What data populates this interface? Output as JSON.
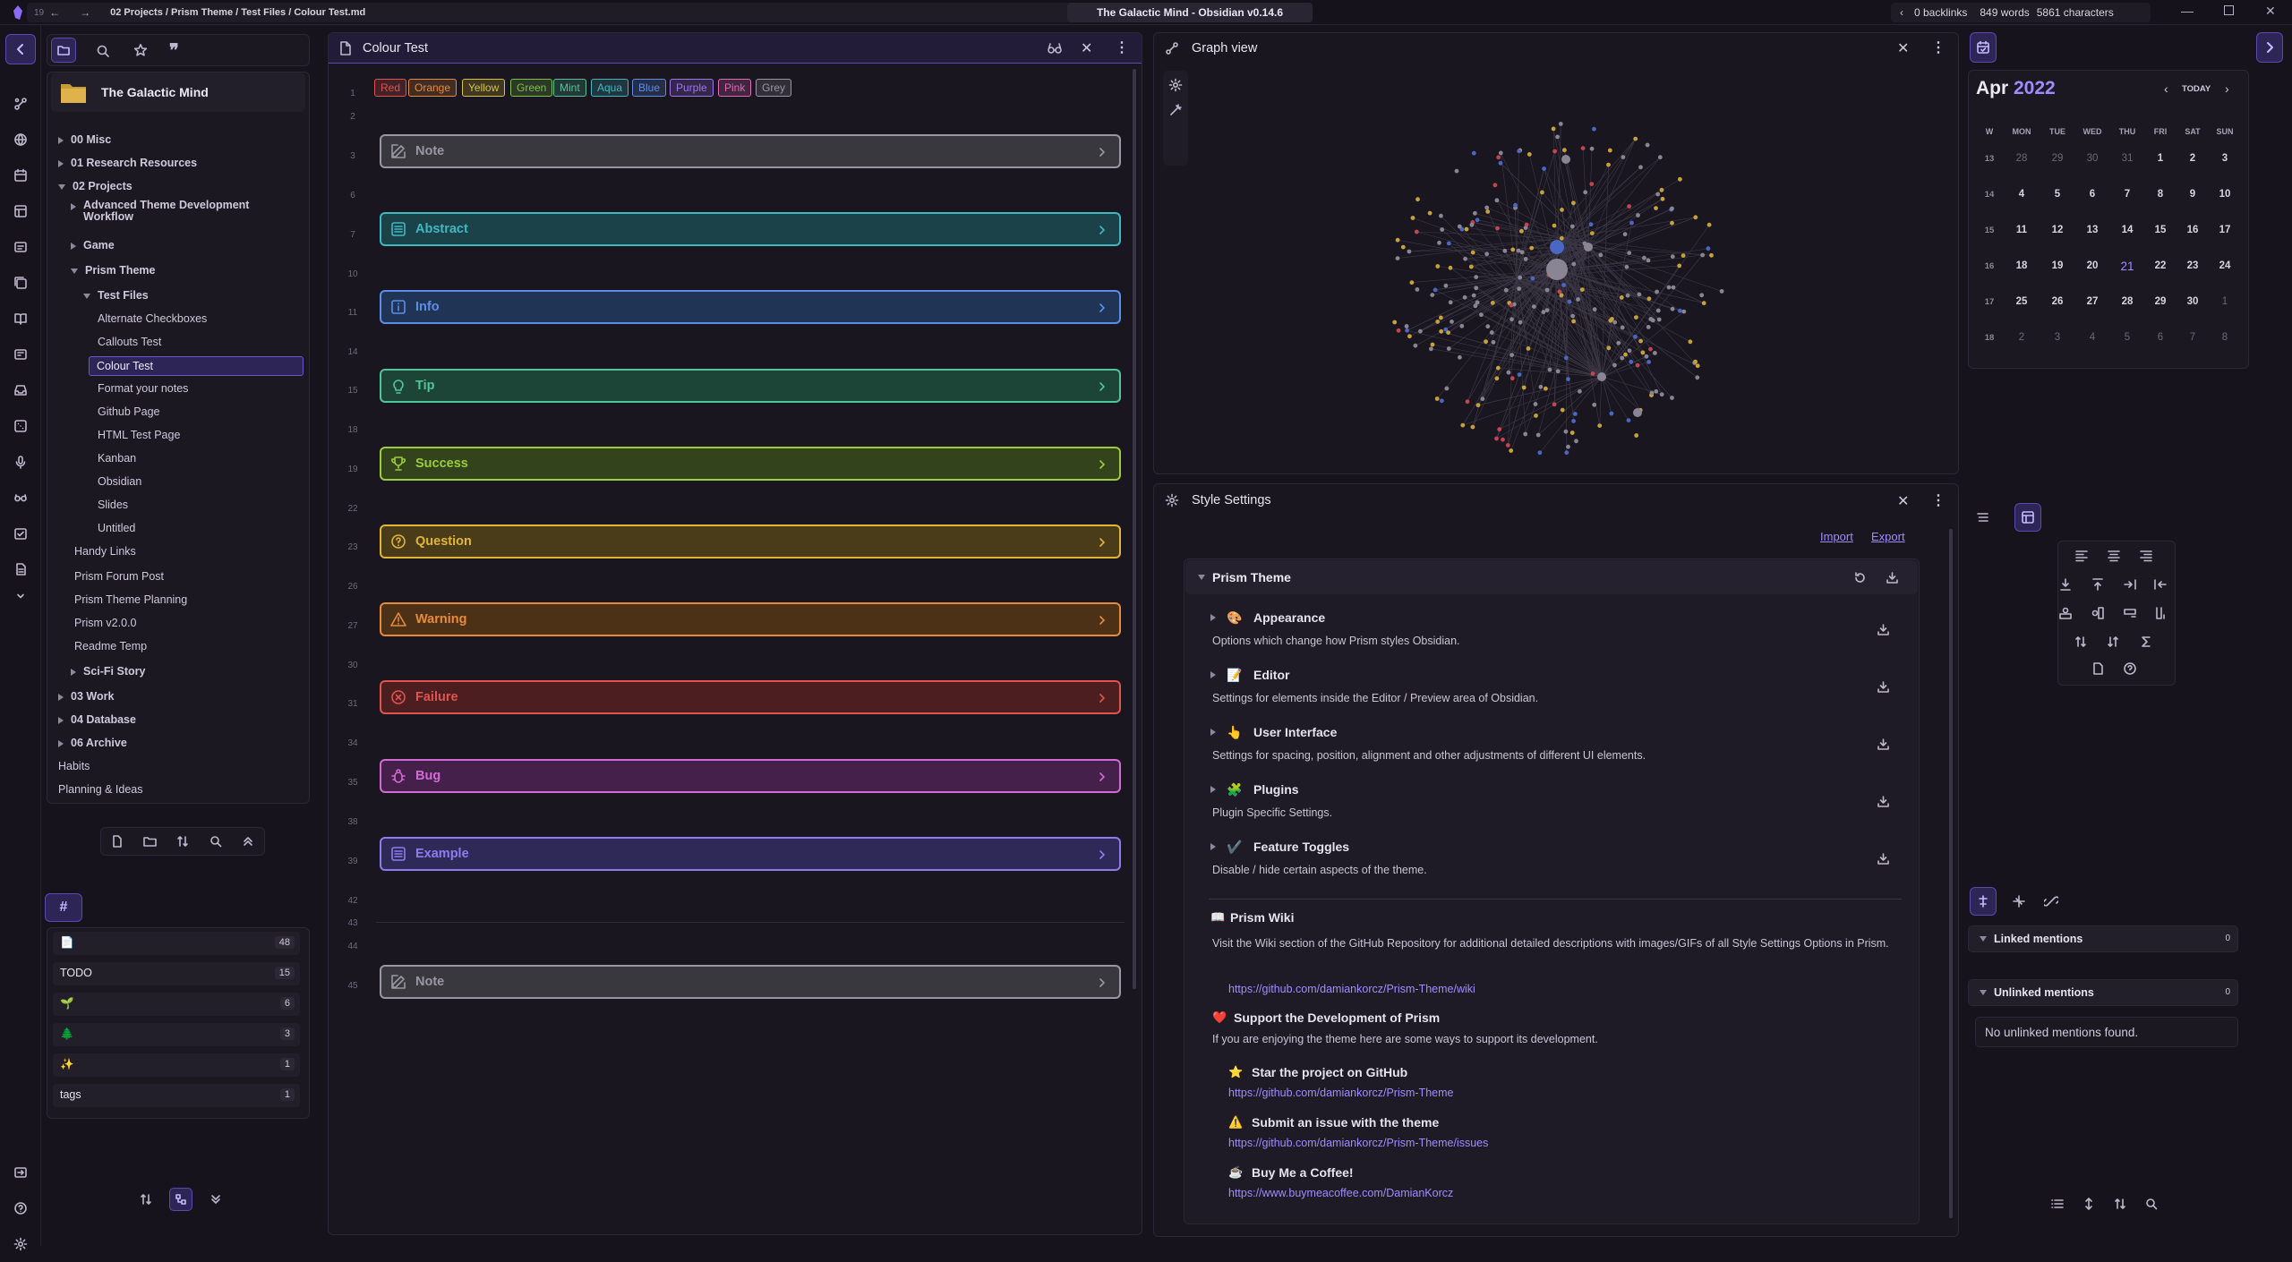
{
  "titlebar": {
    "breadcrumb": "02 Projects / Prism Theme / Test Files / Colour Test.md",
    "history_count": "19",
    "app_title": "The Galactic Mind - Obsidian v0.14.6",
    "backlinks": "0 backlinks",
    "words": "849 words",
    "characters": "5861 characters"
  },
  "vault": {
    "name": "The Galactic Mind"
  },
  "file_tree": [
    {
      "label": "00 Misc",
      "type": "folder-closed"
    },
    {
      "label": "01 Research Resources",
      "type": "folder-closed"
    },
    {
      "label": "02 Projects",
      "type": "folder-open"
    },
    {
      "label": "Advanced Theme Development Workflow",
      "type": "folder-closed"
    },
    {
      "label": "Game",
      "type": "folder-closed"
    },
    {
      "label": "Prism Theme",
      "type": "folder-open"
    },
    {
      "label": "Test Files",
      "type": "folder-open"
    },
    {
      "label": "Alternate Checkboxes",
      "type": "file"
    },
    {
      "label": "Callouts Test",
      "type": "file"
    },
    {
      "label": "Colour Test",
      "type": "file-active"
    },
    {
      "label": "Format your notes",
      "type": "file"
    },
    {
      "label": "Github Page",
      "type": "file"
    },
    {
      "label": "HTML Test Page",
      "type": "file"
    },
    {
      "label": "Kanban",
      "type": "file"
    },
    {
      "label": "Obsidian",
      "type": "file"
    },
    {
      "label": "Slides",
      "type": "file"
    },
    {
      "label": "Untitled",
      "type": "file"
    },
    {
      "label": "Handy Links",
      "type": "file"
    },
    {
      "label": "Prism Forum Post",
      "type": "file"
    },
    {
      "label": "Prism Theme Planning",
      "type": "file"
    },
    {
      "label": "Prism v2.0.0",
      "type": "file"
    },
    {
      "label": "Readme Temp",
      "type": "file"
    },
    {
      "label": "Sci-Fi Story",
      "type": "folder-closed"
    },
    {
      "label": "03 Work",
      "type": "folder-closed"
    },
    {
      "label": "04 Database",
      "type": "folder-closed"
    },
    {
      "label": "06 Archive",
      "type": "folder-closed"
    },
    {
      "label": "Habits",
      "type": "file"
    },
    {
      "label": "Planning & Ideas",
      "type": "file"
    }
  ],
  "tags_pane": {
    "rows": [
      {
        "label": "📄",
        "count": "48"
      },
      {
        "label": "TODO",
        "count": "15"
      },
      {
        "label": "🌱",
        "count": "6"
      },
      {
        "label": "🌲",
        "count": "3"
      },
      {
        "label": "✨",
        "count": "1"
      },
      {
        "label": "tags",
        "count": "1"
      }
    ]
  },
  "editor": {
    "tab_title": "Colour Test",
    "colour_tags": [
      {
        "label": "Red",
        "color": "#e0534f"
      },
      {
        "label": "Orange",
        "color": "#e68a3c"
      },
      {
        "label": "Yellow",
        "color": "#d9c142"
      },
      {
        "label": "Green",
        "color": "#7bc14a"
      },
      {
        "label": "Mint",
        "color": "#53c49a"
      },
      {
        "label": "Aqua",
        "color": "#3fb8c4"
      },
      {
        "label": "Blue",
        "color": "#5c8ee8"
      },
      {
        "label": "Purple",
        "color": "#a073f0"
      },
      {
        "label": "Pink",
        "color": "#e06ac0"
      },
      {
        "label": "Grey",
        "color": "#9a96a3"
      }
    ],
    "line_numbers": [
      "1",
      "2",
      "3",
      "6",
      "7",
      "10",
      "11",
      "14",
      "15",
      "18",
      "19",
      "22",
      "23",
      "26",
      "27",
      "30",
      "31",
      "34",
      "35",
      "38",
      "39",
      "42",
      "43",
      "44",
      "45"
    ],
    "callouts": [
      {
        "label": "Note",
        "color": "#9a96a3",
        "bg": "#3a383f",
        "icon": "pencil-icon"
      },
      {
        "label": "Abstract",
        "color": "#3fb8c4",
        "bg": "#1b4248",
        "icon": "list-icon"
      },
      {
        "label": "Info",
        "color": "#5c8ee8",
        "bg": "#203556",
        "icon": "info-icon"
      },
      {
        "label": "Tip",
        "color": "#53c49a",
        "bg": "#1c4537",
        "icon": "bulb-icon"
      },
      {
        "label": "Success",
        "color": "#9ccc3d",
        "bg": "#33431b",
        "icon": "trophy-icon"
      },
      {
        "label": "Question",
        "color": "#e0b53a",
        "bg": "#4a3c18",
        "icon": "help-icon"
      },
      {
        "label": "Warning",
        "color": "#e68a3c",
        "bg": "#4d3117",
        "icon": "warning-icon"
      },
      {
        "label": "Failure",
        "color": "#e0534f",
        "bg": "#4d1e20",
        "icon": "x-circle-icon"
      },
      {
        "label": "Bug",
        "color": "#d36bd6",
        "bg": "#45204a",
        "icon": "bug-icon"
      },
      {
        "label": "Example",
        "color": "#8c7cf0",
        "bg": "#2f2958",
        "icon": "list-icon"
      },
      {
        "label": "Note",
        "color": "#9a96a3",
        "bg": "#3a383f",
        "icon": "pencil-icon"
      }
    ]
  },
  "graph": {
    "title": "Graph view"
  },
  "style_settings": {
    "title": "Style Settings",
    "import": "Import",
    "export": "Export",
    "theme": "Prism Theme",
    "sections": [
      {
        "emoji": "🎨",
        "title": "Appearance",
        "desc": "Options which change how Prism styles Obsidian."
      },
      {
        "emoji": "📝",
        "title": "Editor",
        "desc": "Settings for elements inside the Editor / Preview area of Obsidian."
      },
      {
        "emoji": "👆",
        "title": "User Interface",
        "desc": "Settings for spacing, position, alignment and other adjustments of different UI elements."
      },
      {
        "emoji": "🧩",
        "title": "Plugins",
        "desc": "Plugin Specific Settings."
      },
      {
        "emoji": "✔️",
        "title": "Feature Toggles",
        "desc": "Disable / hide certain aspects of the theme."
      }
    ],
    "wiki": {
      "emoji": "📖",
      "title": "Prism Wiki",
      "desc": "Visit the Wiki section of the GitHub Repository for additional detailed descriptions with images/GIFs of all Style Settings Options in Prism.",
      "link": "https://github.com/damiankorcz/Prism-Theme/wiki"
    },
    "support": {
      "emoji": "❤️",
      "title": "Support the Development of Prism",
      "desc": "If you are enjoying the theme here are some ways to support its development.",
      "items": [
        {
          "emoji": "⭐",
          "title": "Star the project on GitHub",
          "link": "https://github.com/damiankorcz/Prism-Theme"
        },
        {
          "emoji": "⚠️",
          "title": "Submit an issue with the theme",
          "link": "https://github.com/damiankorcz/Prism-Theme/issues"
        },
        {
          "emoji": "☕",
          "title": "Buy Me a Coffee!",
          "link": "https://www.buymeacoffee.com/DamianKorcz"
        }
      ]
    }
  },
  "calendar": {
    "month": "Apr",
    "year": "2022",
    "today_label": "TODAY",
    "week_header": "W",
    "days": [
      "MON",
      "TUE",
      "WED",
      "THU",
      "FRI",
      "SAT",
      "SUN"
    ],
    "weeks": [
      {
        "wk": "13",
        "d": [
          "28",
          "29",
          "30",
          "31",
          "1",
          "2",
          "3"
        ]
      },
      {
        "wk": "14",
        "d": [
          "4",
          "5",
          "6",
          "7",
          "8",
          "9",
          "10"
        ]
      },
      {
        "wk": "15",
        "d": [
          "11",
          "12",
          "13",
          "14",
          "15",
          "16",
          "17"
        ]
      },
      {
        "wk": "16",
        "d": [
          "18",
          "19",
          "20",
          "21",
          "22",
          "23",
          "24"
        ]
      },
      {
        "wk": "17",
        "d": [
          "25",
          "26",
          "27",
          "28",
          "29",
          "30",
          "1"
        ]
      },
      {
        "wk": "18",
        "d": [
          "2",
          "3",
          "4",
          "5",
          "6",
          "7",
          "8"
        ]
      }
    ],
    "today": "21"
  },
  "backlinks": {
    "linked": "Linked mentions",
    "linked_count": "0",
    "unlinked": "Unlinked mentions",
    "unlinked_count": "0",
    "empty": "No unlinked mentions found."
  }
}
